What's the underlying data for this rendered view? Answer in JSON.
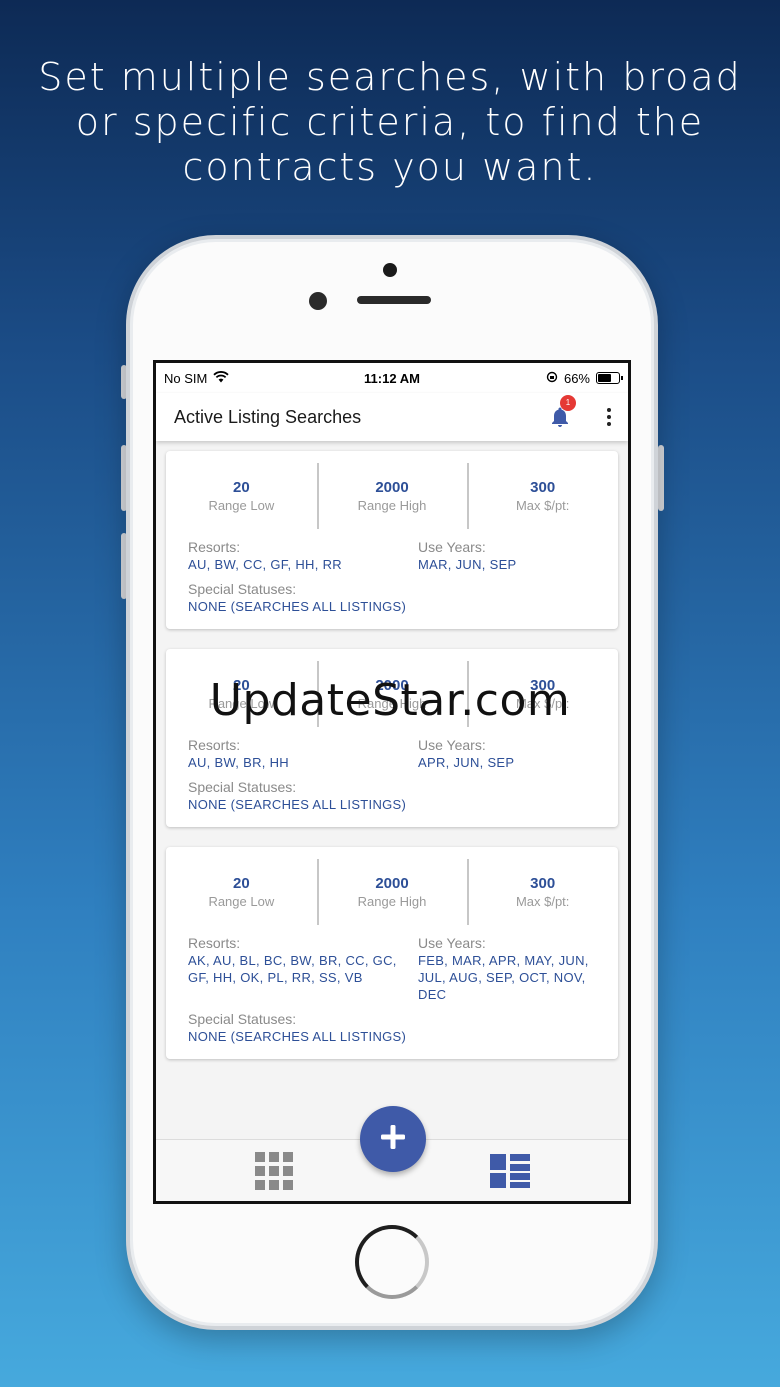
{
  "headline": "Set multiple searches, with broad or specific criteria, to find the contracts you want.",
  "status_bar": {
    "carrier": "No SIM",
    "time": "11:12 AM",
    "battery": "66%",
    "battery_level": 0.66
  },
  "app_bar": {
    "title": "Active Listing Searches",
    "notification_count": "1"
  },
  "labels": {
    "range_low": "Range Low",
    "range_high": "Range High",
    "max_price": "Max $/pt:",
    "resorts": "Resorts:",
    "use_years": "Use Years:",
    "special_statuses": "Special Statuses:"
  },
  "searches": [
    {
      "range_low": "20",
      "range_high": "2000",
      "max_price": "300",
      "resorts": "AU, BW, CC, GF, HH, RR",
      "use_years": "MAR, JUN, SEP",
      "special_statuses": "NONE (SEARCHES ALL LISTINGS)"
    },
    {
      "range_low": "20",
      "range_high": "2000",
      "max_price": "300",
      "resorts": "AU, BW, BR, HH",
      "use_years": "APR, JUN, SEP",
      "special_statuses": "NONE (SEARCHES ALL LISTINGS)"
    },
    {
      "range_low": "20",
      "range_high": "2000",
      "max_price": "300",
      "resorts": "AK, AU, BL, BC, BW, BR, CC, GC, GF, HH, OK, PL, RR, SS, VB",
      "use_years": "FEB, MAR, APR, MAY, JUN, JUL, AUG, SEP, OCT, NOV, DEC",
      "special_statuses": "NONE (SEARCHES ALL LISTINGS)"
    }
  ],
  "watermark": "UpdateStar.com",
  "colors": {
    "accent": "#2d4f97",
    "fab": "#3f5aa8",
    "badge": "#e53935",
    "inactive_icon": "#8a8a8a"
  },
  "icons": {
    "fab": "plus-icon",
    "nav_left": "grid-icon",
    "nav_right": "list-icon",
    "notifications": "bell-icon",
    "menu": "more-vert-icon"
  }
}
